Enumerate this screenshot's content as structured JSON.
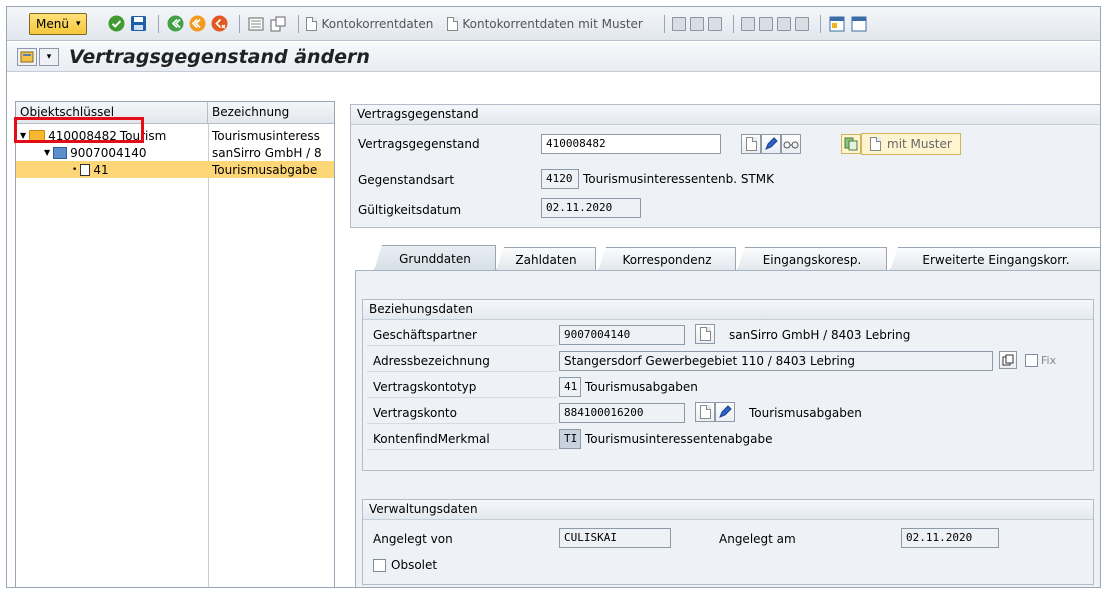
{
  "toolbar": {
    "menu_label": "Menü",
    "kontokorrent_label": "Kontokorrentdaten",
    "kontokorrent_muster_label": "Kontokorrentdaten mit Muster"
  },
  "title": "Vertragsgegenstand ändern",
  "tree": {
    "col_objekt": "Objektschlüssel",
    "col_bez": "Bezeichnung",
    "rows": [
      {
        "key": "410008482",
        "extra": "Tourism",
        "bez": "Tourismusinteress"
      },
      {
        "key": "9007004140",
        "extra": "",
        "bez": "sanSirro GmbH / 8"
      },
      {
        "key": "41",
        "extra": "",
        "bez": "Tourismusabgabe"
      }
    ]
  },
  "vg": {
    "group_title": "Vertragsgegenstand",
    "label_vg": "Vertragsgegenstand",
    "value_vg": "410008482",
    "mm_label": "mit Muster",
    "label_art": "Gegenstandsart",
    "art_code": "4120",
    "art_text": "Tourismusinteressentenb. STMK",
    "label_gueltig": "Gültigkeitsdatum",
    "gueltig_value": "02.11.2020"
  },
  "tabs": [
    "Grunddaten",
    "Zahldaten",
    "Korrespondenz",
    "Eingangskoresp.",
    "Erweiterte Eingangskorr."
  ],
  "bez": {
    "group_title": "Beziehungsdaten",
    "label_gp": "Geschäftspartner",
    "gp_value": "9007004140",
    "gp_text": "sanSirro GmbH / 8403 Lebring",
    "label_adr": "Adressbezeichnung",
    "adr_value": "Stangersdorf Gewerbegebiet 110 / 8403 Lebring",
    "fix_label": "Fix",
    "label_vkt": "Vertragskontotyp",
    "vkt_code": "41",
    "vkt_text": "Tourismusabgaben",
    "label_vk": "Vertragskonto",
    "vk_value": "884100016200",
    "vk_text": "Tourismusabgaben",
    "label_kfm": "KontenfindMerkmal",
    "kfm_code": "TI",
    "kfm_text": "Tourismusinteressentenabgabe"
  },
  "verw": {
    "group_title": "Verwaltungsdaten",
    "label_von": "Angelegt von",
    "von_value": "CULISKAI",
    "label_am": "Angelegt am",
    "am_value": "02.11.2020",
    "obsolet_label": "Obsolet"
  }
}
